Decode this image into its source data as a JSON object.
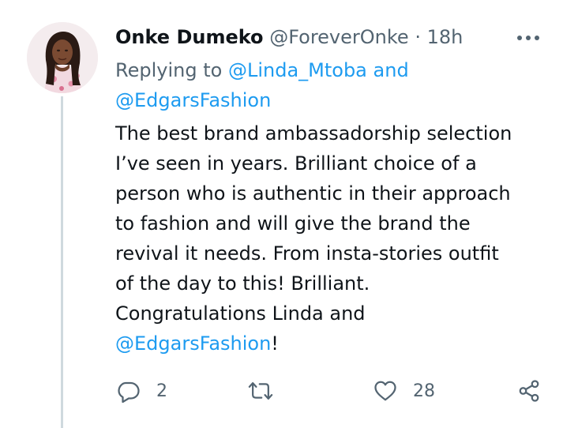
{
  "tweet": {
    "display_name": "Onke Dumeko",
    "handle": "@ForeverOnke",
    "separator": "·",
    "time": "18h",
    "more_icon": "more-horizontal-icon",
    "replying_prefix": "Replying to",
    "replying_mention_1": "@Linda_Mtoba",
    "replying_and": "and",
    "replying_mention_2": "@EdgarsFashion",
    "body_lines": [
      "The best brand ambassadorship selection",
      "I’ve seen in years. Brilliant choice of a",
      "person who is authentic in their approach",
      "to fashion and will give the brand the",
      "revival it needs. From insta-stories outfit",
      "of the day to this! Brilliant.",
      "Congratulations Linda and"
    ],
    "body_mention": "@EdgarsFashion",
    "body_end": "!"
  },
  "actions": {
    "reply": {
      "icon": "reply-icon",
      "count": "2"
    },
    "retweet": {
      "icon": "retweet-icon",
      "count": ""
    },
    "like": {
      "icon": "heart-icon",
      "count": "28"
    },
    "share": {
      "icon": "share-icon"
    }
  },
  "colors": {
    "text": "#0f1419",
    "secondary": "#536471",
    "link": "#1d9bf0",
    "thread_line": "#cfd9de"
  }
}
